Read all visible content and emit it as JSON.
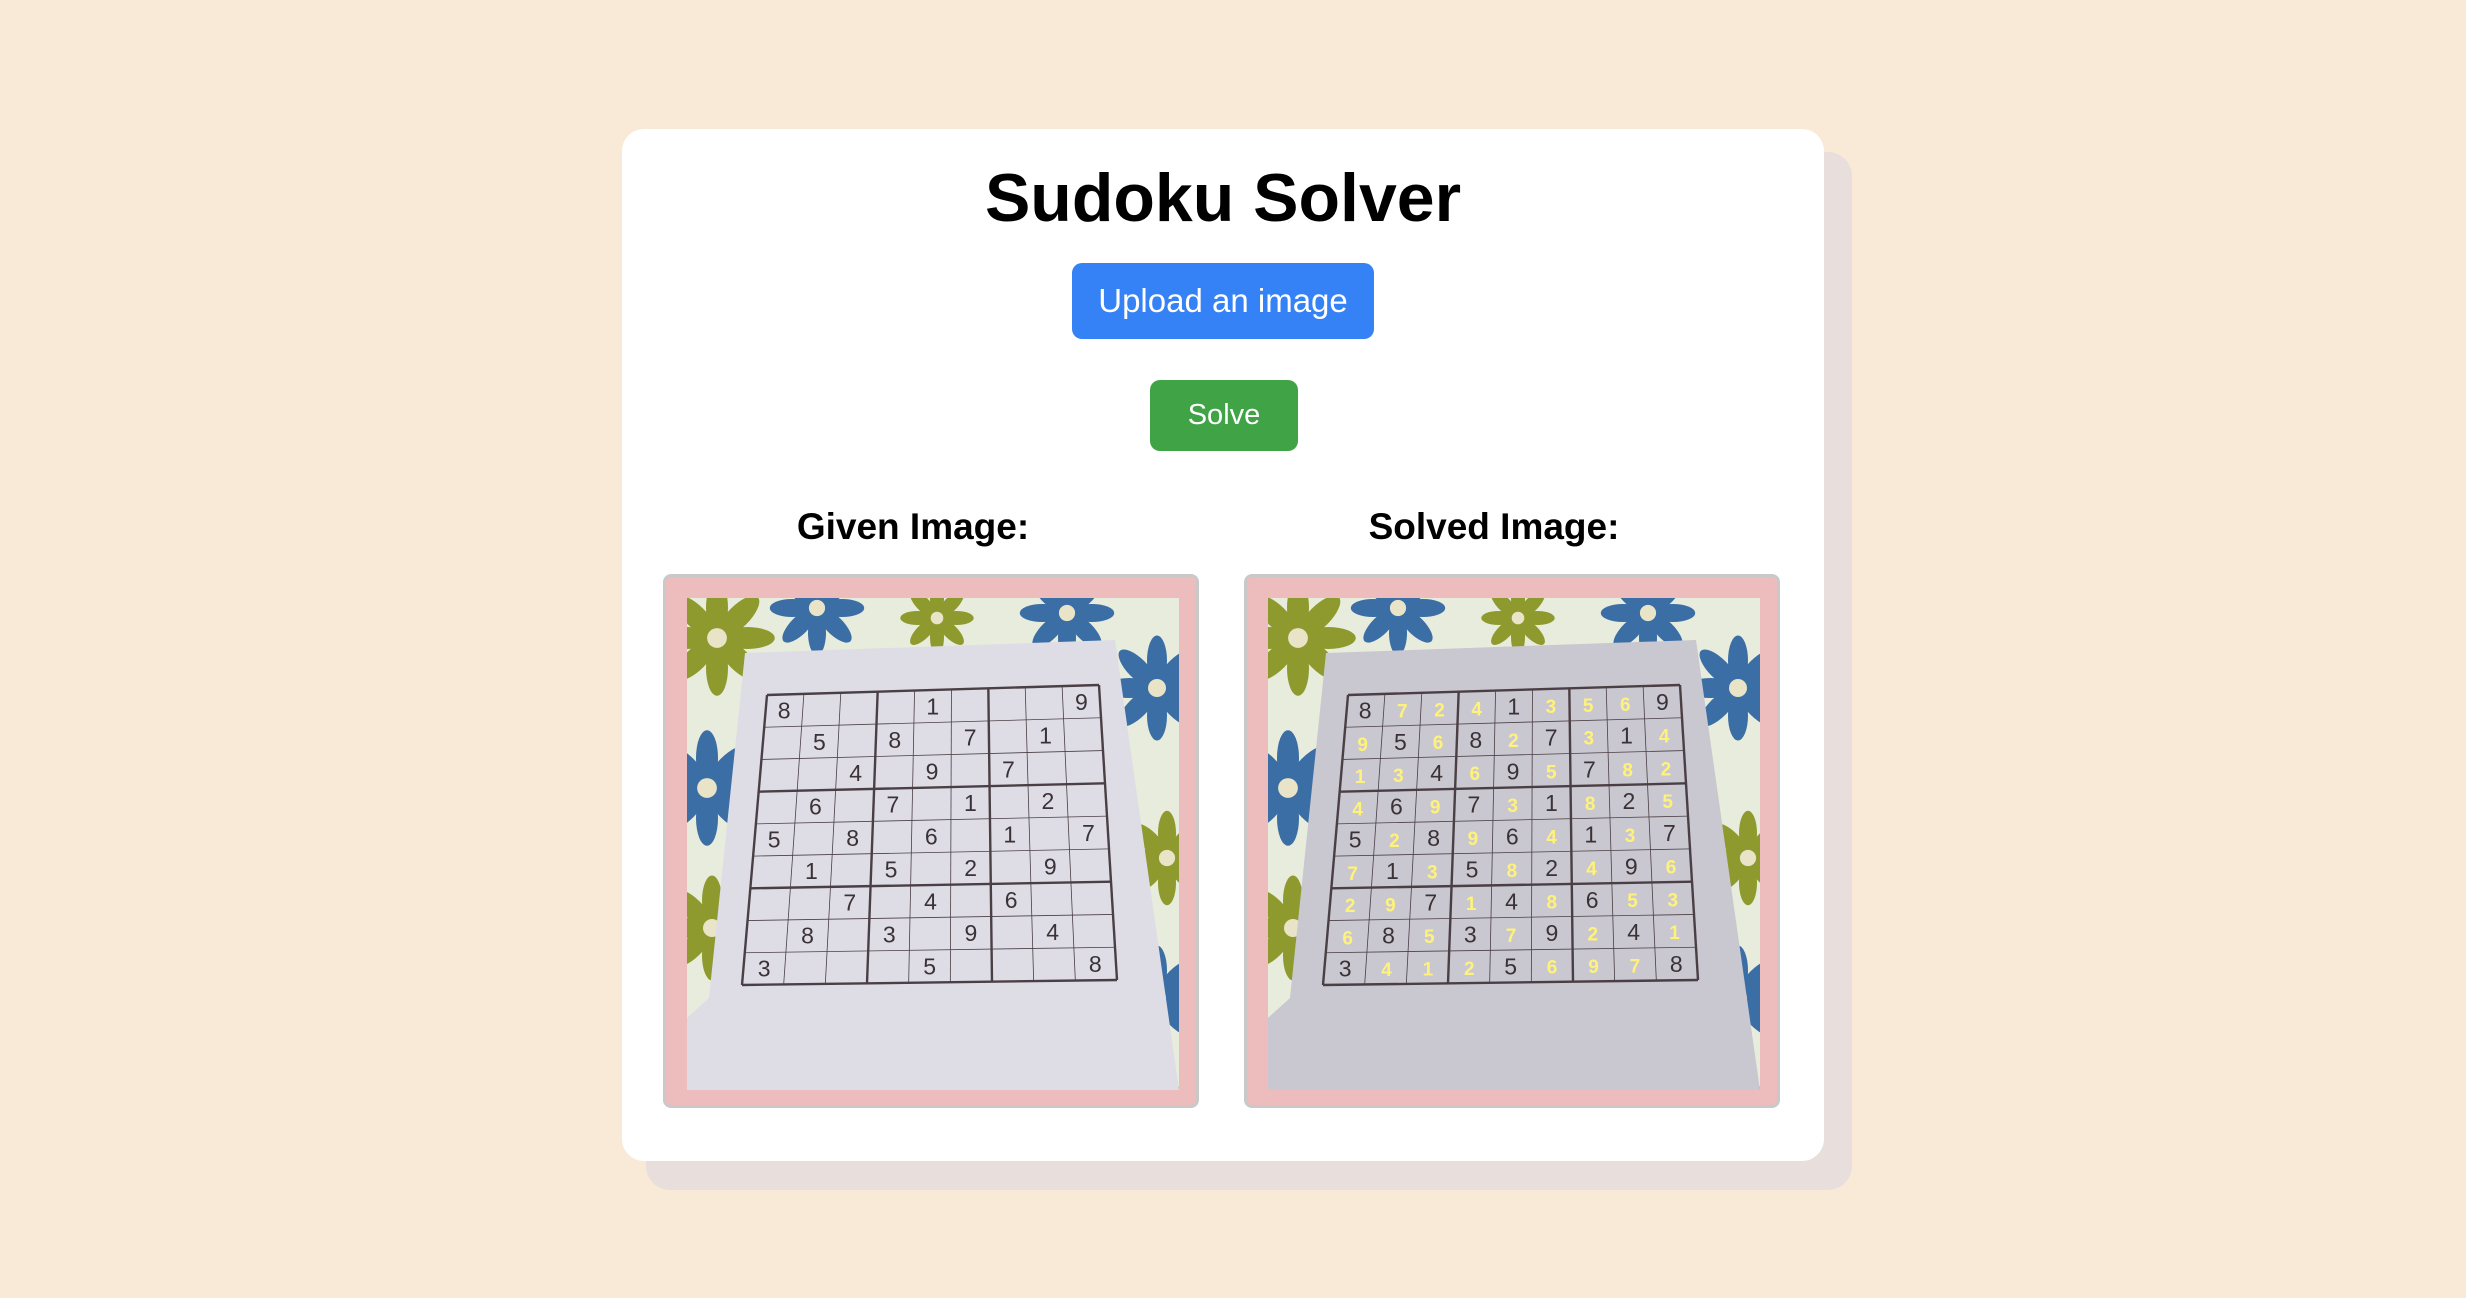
{
  "app": {
    "title": "Sudoku Solver",
    "upload_label": "Upload an image",
    "solve_label": "Solve",
    "given_label": "Given Image:",
    "solved_label": "Solved Image:"
  },
  "colors": {
    "background": "#f8ead7",
    "upload_button": "#3581f6",
    "solve_button": "#40a346",
    "frame": "#edbcbc",
    "solution_digit": "#fff27a"
  },
  "puzzle": {
    "given": [
      "8   1   9",
      " 5 8 7 1 ",
      "  4 9 7  ",
      " 6 7 1 2 ",
      "5 8 6 1 7",
      " 1 5 2 9 ",
      "  7 4 6  ",
      " 8 3 9 4 ",
      "3   5   8"
    ],
    "solved": [
      "872413569",
      "956827314",
      "134695782",
      "469731825",
      "528964137",
      "713582496",
      "297148653",
      "685379241",
      "341256978"
    ]
  }
}
